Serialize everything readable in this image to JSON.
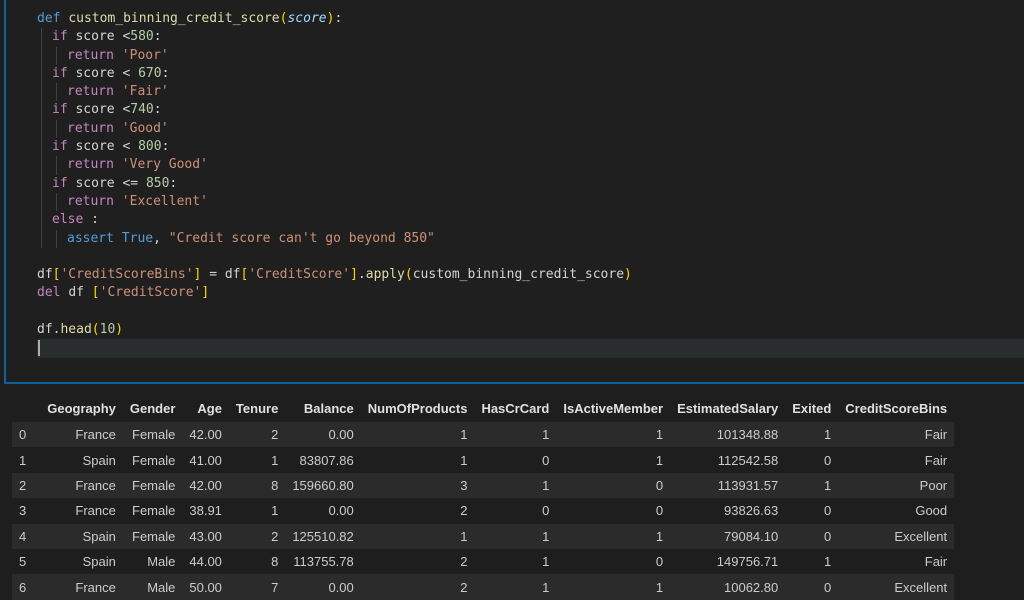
{
  "code": {
    "func_def": "custom_binning_credit_score",
    "param": "score",
    "lines": {
      "l2_num": "580",
      "l3_ret": "'Poor'",
      "l4_num": "670",
      "l5_ret": "'Fair'",
      "l6_num": "740",
      "l7_ret": "'Good'",
      "l8_num": "800",
      "l9_ret": "'Very Good'",
      "l10_num": "850",
      "l11_ret": "'Excellent'",
      "l13_msg": "\"Credit score can't go beyond 850\"",
      "l15_key1": "'CreditScoreBins'",
      "l15_key2": "'CreditScore'",
      "l15_fn": "custom_binning_credit_score",
      "l16_key": "'CreditScore'",
      "l18_num": "10"
    }
  },
  "table": {
    "columns": [
      "",
      "Geography",
      "Gender",
      "Age",
      "Tenure",
      "Balance",
      "NumOfProducts",
      "HasCrCard",
      "IsActiveMember",
      "EstimatedSalary",
      "Exited",
      "CreditScoreBins"
    ],
    "rows": [
      [
        "0",
        "France",
        "Female",
        "42.00",
        "2",
        "0.00",
        "1",
        "1",
        "1",
        "101348.88",
        "1",
        "Fair"
      ],
      [
        "1",
        "Spain",
        "Female",
        "41.00",
        "1",
        "83807.86",
        "1",
        "0",
        "1",
        "112542.58",
        "0",
        "Fair"
      ],
      [
        "2",
        "France",
        "Female",
        "42.00",
        "8",
        "159660.80",
        "3",
        "1",
        "0",
        "113931.57",
        "1",
        "Poor"
      ],
      [
        "3",
        "France",
        "Female",
        "38.91",
        "1",
        "0.00",
        "2",
        "0",
        "0",
        "93826.63",
        "0",
        "Good"
      ],
      [
        "4",
        "Spain",
        "Female",
        "43.00",
        "2",
        "125510.82",
        "1",
        "1",
        "1",
        "79084.10",
        "0",
        "Excellent"
      ],
      [
        "5",
        "Spain",
        "Male",
        "44.00",
        "8",
        "113755.78",
        "2",
        "1",
        "0",
        "149756.71",
        "1",
        "Fair"
      ],
      [
        "6",
        "France",
        "Male",
        "50.00",
        "7",
        "0.00",
        "2",
        "1",
        "1",
        "10062.80",
        "0",
        "Excellent"
      ]
    ]
  }
}
